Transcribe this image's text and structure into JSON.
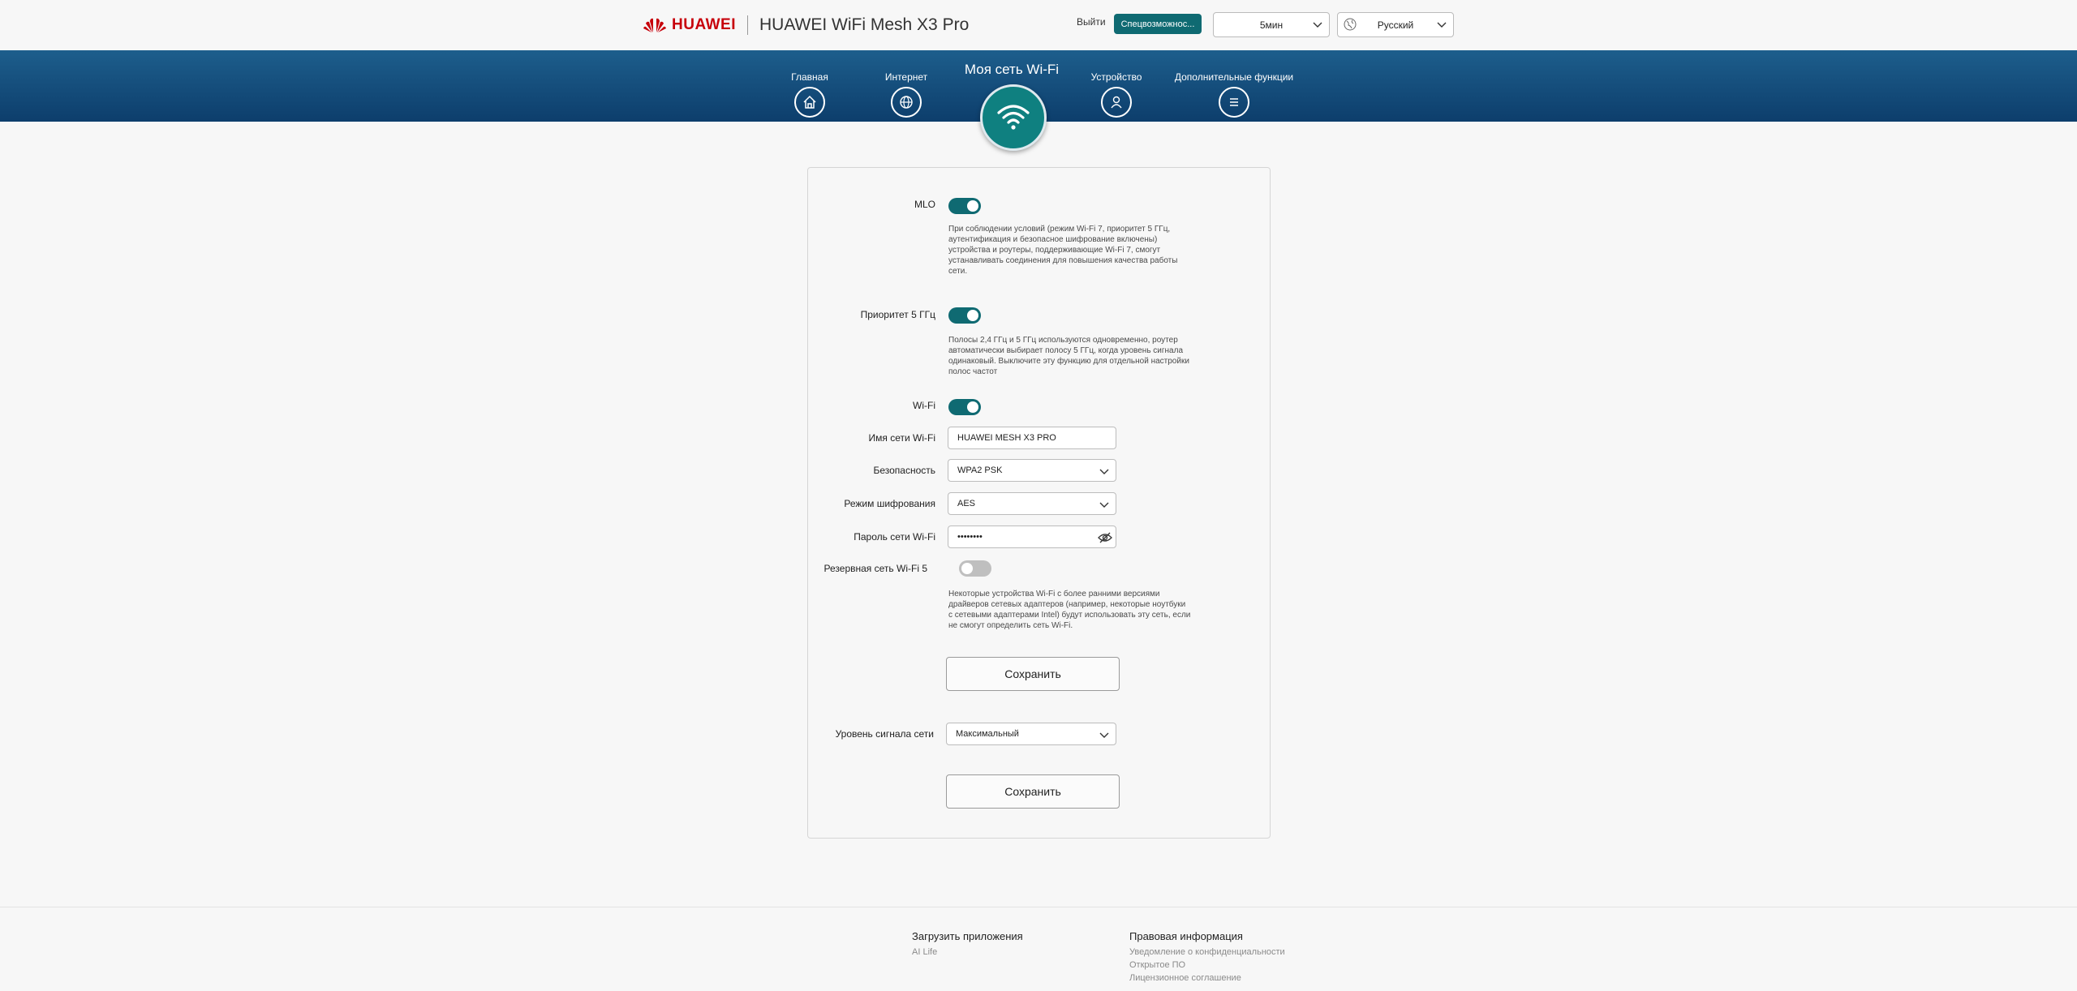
{
  "header": {
    "brand": "HUAWEI",
    "product": "HUAWEI WiFi Mesh X3 Pro",
    "logout": "Выйти",
    "special_button": "Спецвозможнос...",
    "timeout_value": "5мин",
    "language_value": "Русский",
    "brand_color": "#c7000b",
    "accent_color": "#0f6a72"
  },
  "nav": {
    "items": [
      {
        "label": "Главная",
        "icon": "home-icon"
      },
      {
        "label": "Интернет",
        "icon": "globe-icon"
      },
      {
        "label": "Моя сеть Wi-Fi",
        "icon": "wifi-icon",
        "active": true
      },
      {
        "label": "Устройство",
        "icon": "user-icon"
      },
      {
        "label": "Дополнительные функции",
        "icon": "menu-icon"
      }
    ]
  },
  "settings": {
    "mlo": {
      "label": "MLO",
      "enabled": true,
      "description": "При соблюдении условий (режим Wi-Fi 7, приоритет 5 ГГц, аутентификация и безопасное шифрование включены) устройства и роутеры, поддерживающие Wi-Fi 7, смогут устанавливать соединения для повышения качества работы сети."
    },
    "priority5g": {
      "label": "Приоритет 5 ГГц",
      "enabled": true,
      "description": "Полосы 2,4 ГГц и 5 ГГц используются одновременно, роутер автоматически выбирает полосу 5 ГГц, когда уровень сигнала одинаковый. Выключите эту функцию для отдельной настройки полос частот"
    },
    "wifi": {
      "label": "Wi-Fi",
      "enabled": true
    },
    "ssid": {
      "label": "Имя сети Wi-Fi",
      "value": "HUAWEI MESH X3 PRO"
    },
    "security": {
      "label": "Безопасность",
      "value": "WPA2 PSK"
    },
    "encryption": {
      "label": "Режим шифрования",
      "value": "AES"
    },
    "password": {
      "label": "Пароль сети Wi-Fi",
      "value": "••••••••"
    },
    "backup_wifi5": {
      "label": "Резервная сеть Wi-Fi 5",
      "enabled": false,
      "description": "Некоторые устройства Wi-Fi с более ранними версиями драйверов сетевых адаптеров (например, некоторые ноутбуки с сетевыми адаптерами Intel) будут использовать эту сеть, если не смогут определить сеть Wi-Fi."
    },
    "save_label": "Сохранить",
    "signal": {
      "label": "Уровень сигнала сети",
      "value": "Максимальный"
    },
    "save2_label": "Сохранить"
  },
  "footer": {
    "apps_heading": "Загрузить приложения",
    "apps_link": "AI Life",
    "legal_heading": "Правовая информация",
    "legal_links": [
      "Уведомление о конфиденциальности",
      "Открытое ПО",
      "Лицензионное соглашение"
    ]
  }
}
